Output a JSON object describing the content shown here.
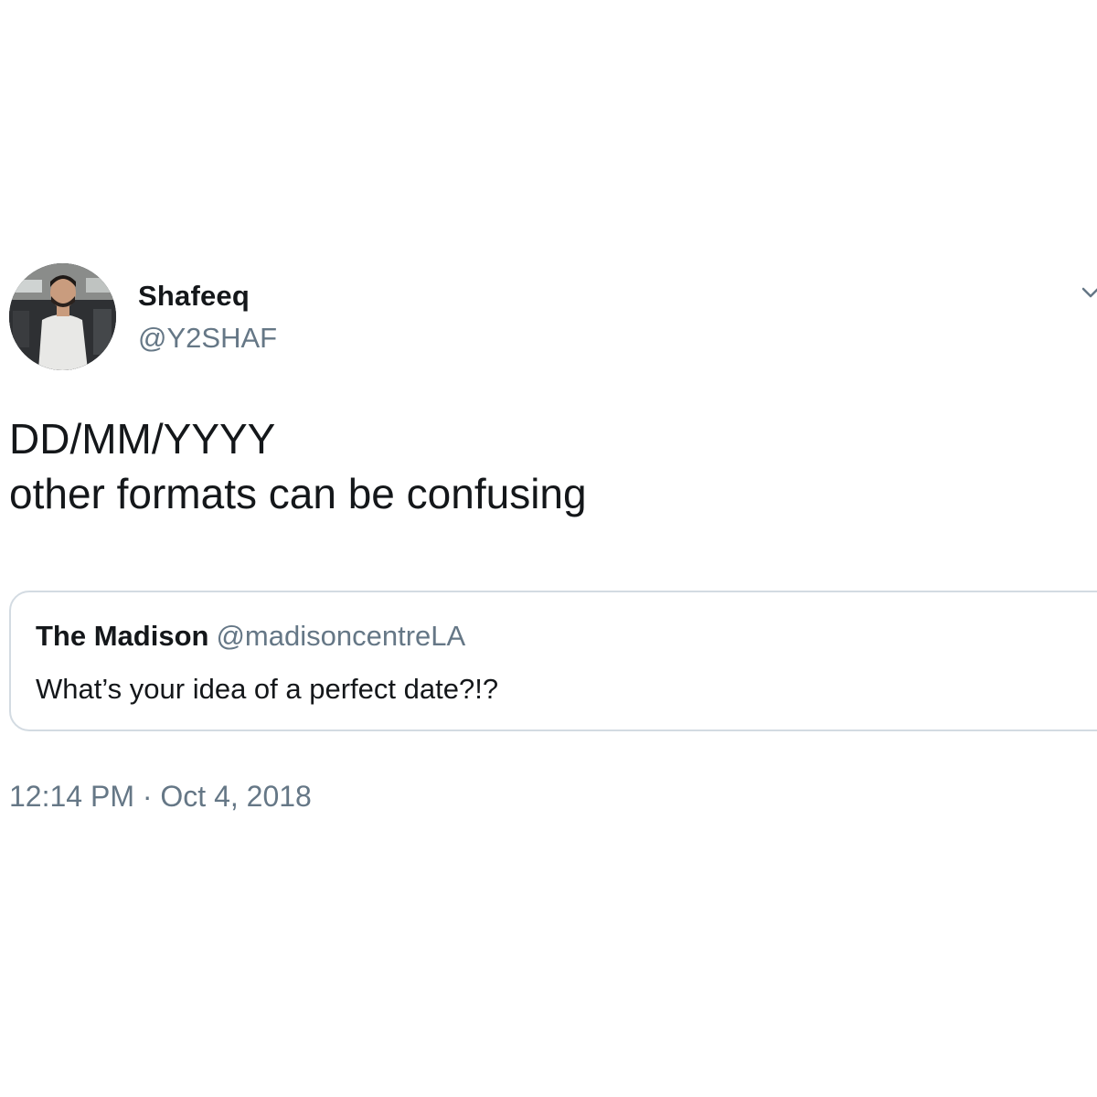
{
  "author": {
    "name": "Shafeeq",
    "handle": "@Y2SHAF"
  },
  "tweet": {
    "line1": "DD/MM/YYYY",
    "line2": "other formats can be confusing"
  },
  "quoted_tweet": {
    "name": "The Madison",
    "handle": "@madisoncentreLA",
    "text": "What’s your idea of a perfect date?!?"
  },
  "timestamp": "12:14 PM · Oct 4, 2018",
  "colors": {
    "text_primary": "#14171a",
    "text_secondary": "#657786",
    "border": "#d3dbe2",
    "background": "#ffffff"
  },
  "icons": {
    "menu": "chevron-down-icon",
    "avatar": "profile-photo"
  }
}
